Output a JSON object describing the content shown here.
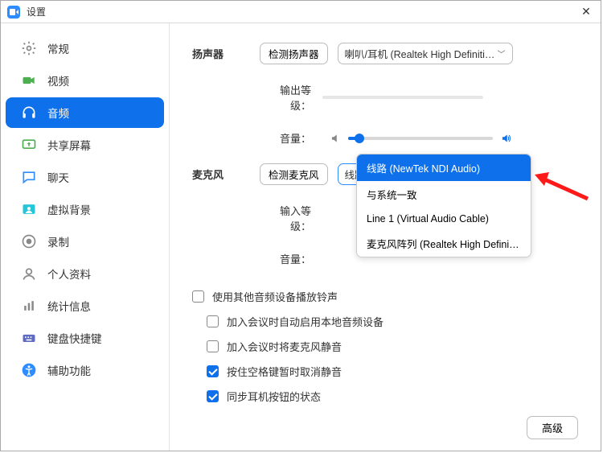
{
  "title": "设置",
  "sidebar": {
    "items": [
      {
        "label": "常规"
      },
      {
        "label": "视频"
      },
      {
        "label": "音频"
      },
      {
        "label": "共享屏幕"
      },
      {
        "label": "聊天"
      },
      {
        "label": "虚拟背景"
      },
      {
        "label": "录制"
      },
      {
        "label": "个人资料"
      },
      {
        "label": "统计信息"
      },
      {
        "label": "键盘快捷键"
      },
      {
        "label": "辅助功能"
      }
    ]
  },
  "speaker": {
    "section": "扬声器",
    "test_btn": "检测扬声器",
    "device": "喇叭/耳机 (Realtek High Definiti…",
    "output_label": "输出等级：",
    "volume_label": "音量："
  },
  "mic": {
    "section": "麦克风",
    "test_btn": "检测麦克风",
    "device": "线路 (NewTek NDI Audio)",
    "input_label": "输入等级：",
    "volume_label": "音量：",
    "options": [
      "线路 (NewTek NDI Audio)",
      "与系统一致",
      "Line 1 (Virtual Audio Cable)",
      "麦克风阵列 (Realtek High Definition …"
    ]
  },
  "checks": [
    {
      "label": "使用其他音频设备播放铃声",
      "on": false
    },
    {
      "label": "加入会议时自动启用本地音频设备",
      "on": false
    },
    {
      "label": "加入会议时将麦克风静音",
      "on": false
    },
    {
      "label": "按住空格键暂时取消静音",
      "on": true
    },
    {
      "label": "同步耳机按钮的状态",
      "on": true
    }
  ],
  "advanced": "高级"
}
